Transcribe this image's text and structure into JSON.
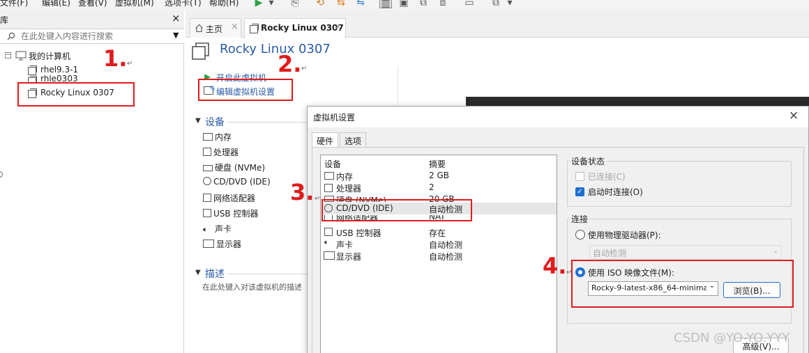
{
  "menubar": {
    "items": [
      "文件(F)",
      "编辑(E)",
      "查看(V)",
      "虚拟机(M)",
      "选项卡(T)",
      "帮助(H)"
    ]
  },
  "library": {
    "title": "库",
    "close": "×",
    "search_placeholder": "在此处键入内容进行搜索",
    "root": "我的计算机",
    "vms": [
      "rhel9.3-1",
      "rhle0303",
      "Rocky Linux 0307"
    ]
  },
  "tabs": {
    "home": "主页",
    "vm": "Rocky Linux 0307",
    "close": "×"
  },
  "vm_page": {
    "title": "Rocky Linux 0307",
    "power_on": "开启此虚拟机",
    "edit_settings": "编辑虚拟机设置",
    "devices_heading": "设备",
    "devices": [
      "内存",
      "处理器",
      "硬盘 (NVMe)",
      "CD/DVD (IDE)",
      "网络适配器",
      "USB 控制器",
      "声卡",
      "显示器"
    ],
    "description_heading": "描述",
    "description_placeholder": "在此处键入对该虚拟机的描述"
  },
  "steps": {
    "s1": "1.",
    "s2": "2.",
    "s3": "3.",
    "s4": "4.",
    "return_mark": "↵"
  },
  "dialog": {
    "title": "虚拟机设置",
    "close": "×",
    "tab_hardware": "硬件",
    "tab_options": "选项",
    "list_header_device": "设备",
    "list_header_summary": "摘要",
    "rows": [
      {
        "device": "内存",
        "summary": "2 GB"
      },
      {
        "device": "处理器",
        "summary": "2"
      },
      {
        "device": "硬盘 (NVMe)",
        "summary": "20 GB"
      },
      {
        "device": "CD/DVD (IDE)",
        "summary": "自动检测"
      },
      {
        "device": "网络适配器",
        "summary": "NAT"
      },
      {
        "device": "USB 控制器",
        "summary": "存在"
      },
      {
        "device": "声卡",
        "summary": "自动检测"
      },
      {
        "device": "显示器",
        "summary": "自动检测"
      }
    ],
    "device_status": {
      "title": "设备状态",
      "connected": "已连接(C)",
      "connect_at_power_on": "启动时连接(O)"
    },
    "connection": {
      "title": "连接",
      "physical_drive": "使用物理驱动器(P):",
      "physical_value": "自动检测",
      "iso": "使用 ISO 映像文件(M):",
      "iso_value": "Rocky-9-latest-x86_64-minima",
      "browse": "浏览(B)...",
      "advanced": "高级(V)..."
    }
  },
  "watermark": "CSDN @YO-YO.YYY",
  "colors": {
    "accent": "#2a5aa6",
    "annotation": "#e11b1b",
    "checkbox_blue": "#1f6fd1"
  }
}
